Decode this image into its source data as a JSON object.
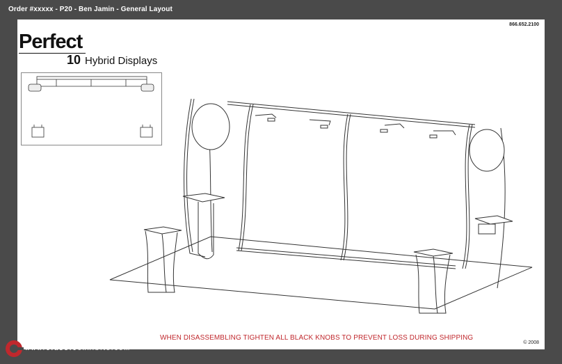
{
  "header": {
    "title": "Order #xxxxx -  P20 - Ben Jamin - General Layout"
  },
  "sheet": {
    "phone": "866.652.2100",
    "logo": {
      "word": "Perfect",
      "number": "10",
      "subtitle": "Hybrid Displays"
    },
    "warning": "WHEN DISASSEMBLING TIGHTEN ALL BLACK KNOBS TO PREVENT LOSS DURING SHIPPING",
    "copyright": "© 2008"
  },
  "footer": {
    "brand_prefix": "www.",
    "brand_bold": "classic",
    "brand_suffix": "exhibits.com"
  },
  "colors": {
    "frame": "#4a4a4a",
    "warning": "#c0282d",
    "brand_red": "#c0282d"
  }
}
